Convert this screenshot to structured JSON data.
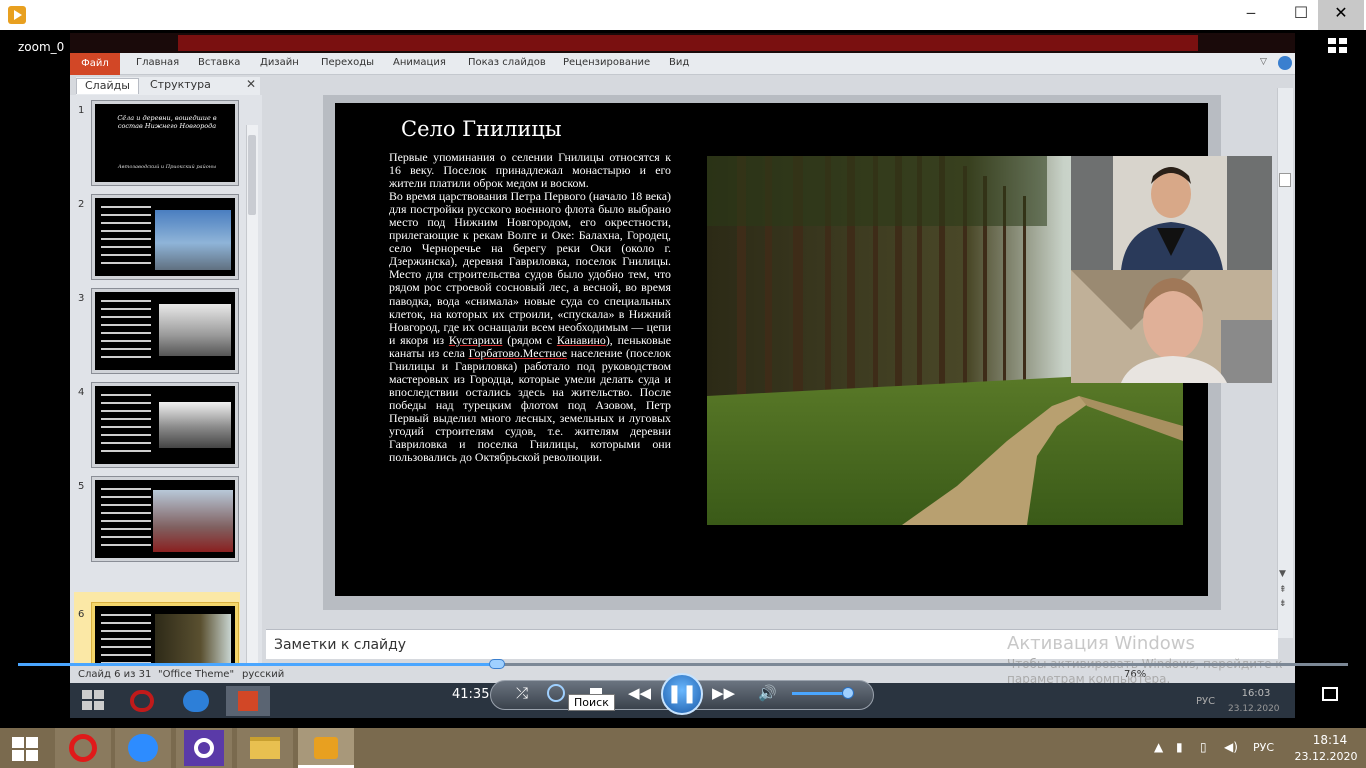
{
  "window": {
    "minimize": "‒",
    "maximize": "☐",
    "close": "✕"
  },
  "player": {
    "title": "zoom_0",
    "elapsed": "41:35",
    "progress_fraction": 0.36,
    "volume_fraction": 0.9,
    "tooltip": "Поиск",
    "accent": "#4aa6ff"
  },
  "ribbon": {
    "file": "Файл",
    "tabs": [
      "Главная",
      "Вставка",
      "Дизайн",
      "Переходы",
      "Анимация",
      "Показ слайдов",
      "Рецензирование",
      "Вид"
    ],
    "accent": "#d24726"
  },
  "pane": {
    "tab_slides": "Слайды",
    "tab_structure": "Структура",
    "close": "✕",
    "numbers": [
      "1",
      "2",
      "3",
      "4",
      "5",
      "6"
    ],
    "thumb1_title": "Сёла и деревни, вошедшие в состав Нижнего Новгорода",
    "thumb1_sub": "Автозаводский и Приокский районы"
  },
  "slide": {
    "title": "Село Гнилицы",
    "body_1": "Первые упоминания  о селении Гнилицы относятся к 16 веку. Поселок принадлежал монастырю и его жители платили оброк медом и воском.",
    "body_2": "Во время царствования  Петра Первого (начало 18 века) для постройки  русского военного флота было выбрано место под Нижним Новгородом, его окрестности,  прилегающие  к рекам Волге и Оке: Балахна, Городец, село Черноречье на берегу реки Оки (около г. Дзержинска),  деревня Гавриловка,  поселок Гнилицы.  Место для строительства судов было удобно тем, что рядом рос строевой  сосновый  лес, а весной,  во время паводка, вода «снимала» новые суда со специальных  клеток, на которых их строили, «спускала» в Нижний  Новгород, где их оснащали  всем необходимым  — цепи и якоря из ",
    "link_1": "Кустарихи",
    "body_3": " (рядом  с ",
    "link_2": "Канавино",
    "body_4": "), пеньковые  канаты из села ",
    "link_3": "Горбатово.Местное",
    "body_5": " население  (поселок  Гнилицы   и  Гавриловка) работало под руководством  мастеровых  из Городца, которые умели делать суда и впоследствии  остались здесь на жительство. После победы над турецким  флотом под Азовом, Петр Первый выделил много лесных, земельных и луговых  угодий строителям судов, т.е. жителям деревни Гавриловка и поселка Гнилицы,  которыми они пользовались  до Октябрьской революции."
  },
  "notes": {
    "label": "Заметки к слайду"
  },
  "status": {
    "slide": "Слайд 6 из 31",
    "theme": "\"Office Theme\"",
    "lang": "русский",
    "zoom": "76%"
  },
  "activation": {
    "line1": "Активация Windows",
    "line2": "Чтобы активировать Windows, перейдите к параметрам компьютера."
  },
  "inner_tray": {
    "lang": "РУС",
    "time": "16:03",
    "date": "23.12.2020"
  },
  "taskbar": {
    "lang": "РУС",
    "time": "18:14",
    "date": "23.12.2020"
  }
}
